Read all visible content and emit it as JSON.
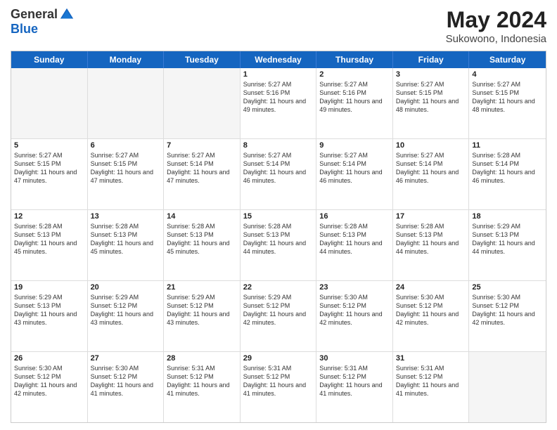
{
  "logo": {
    "general": "General",
    "blue": "Blue"
  },
  "title": {
    "month": "May 2024",
    "location": "Sukowono, Indonesia"
  },
  "calendar": {
    "headers": [
      "Sunday",
      "Monday",
      "Tuesday",
      "Wednesday",
      "Thursday",
      "Friday",
      "Saturday"
    ],
    "rows": [
      [
        {
          "day": "",
          "empty": true
        },
        {
          "day": "",
          "empty": true
        },
        {
          "day": "",
          "empty": true
        },
        {
          "day": "1",
          "sunrise": "5:27 AM",
          "sunset": "5:16 PM",
          "daylight": "11 hours and 49 minutes."
        },
        {
          "day": "2",
          "sunrise": "5:27 AM",
          "sunset": "5:16 PM",
          "daylight": "11 hours and 49 minutes."
        },
        {
          "day": "3",
          "sunrise": "5:27 AM",
          "sunset": "5:15 PM",
          "daylight": "11 hours and 48 minutes."
        },
        {
          "day": "4",
          "sunrise": "5:27 AM",
          "sunset": "5:15 PM",
          "daylight": "11 hours and 48 minutes."
        }
      ],
      [
        {
          "day": "5",
          "sunrise": "5:27 AM",
          "sunset": "5:15 PM",
          "daylight": "11 hours and 47 minutes."
        },
        {
          "day": "6",
          "sunrise": "5:27 AM",
          "sunset": "5:15 PM",
          "daylight": "11 hours and 47 minutes."
        },
        {
          "day": "7",
          "sunrise": "5:27 AM",
          "sunset": "5:14 PM",
          "daylight": "11 hours and 47 minutes."
        },
        {
          "day": "8",
          "sunrise": "5:27 AM",
          "sunset": "5:14 PM",
          "daylight": "11 hours and 46 minutes."
        },
        {
          "day": "9",
          "sunrise": "5:27 AM",
          "sunset": "5:14 PM",
          "daylight": "11 hours and 46 minutes."
        },
        {
          "day": "10",
          "sunrise": "5:27 AM",
          "sunset": "5:14 PM",
          "daylight": "11 hours and 46 minutes."
        },
        {
          "day": "11",
          "sunrise": "5:28 AM",
          "sunset": "5:14 PM",
          "daylight": "11 hours and 46 minutes."
        }
      ],
      [
        {
          "day": "12",
          "sunrise": "5:28 AM",
          "sunset": "5:13 PM",
          "daylight": "11 hours and 45 minutes."
        },
        {
          "day": "13",
          "sunrise": "5:28 AM",
          "sunset": "5:13 PM",
          "daylight": "11 hours and 45 minutes."
        },
        {
          "day": "14",
          "sunrise": "5:28 AM",
          "sunset": "5:13 PM",
          "daylight": "11 hours and 45 minutes."
        },
        {
          "day": "15",
          "sunrise": "5:28 AM",
          "sunset": "5:13 PM",
          "daylight": "11 hours and 44 minutes."
        },
        {
          "day": "16",
          "sunrise": "5:28 AM",
          "sunset": "5:13 PM",
          "daylight": "11 hours and 44 minutes."
        },
        {
          "day": "17",
          "sunrise": "5:28 AM",
          "sunset": "5:13 PM",
          "daylight": "11 hours and 44 minutes."
        },
        {
          "day": "18",
          "sunrise": "5:29 AM",
          "sunset": "5:13 PM",
          "daylight": "11 hours and 44 minutes."
        }
      ],
      [
        {
          "day": "19",
          "sunrise": "5:29 AM",
          "sunset": "5:13 PM",
          "daylight": "11 hours and 43 minutes."
        },
        {
          "day": "20",
          "sunrise": "5:29 AM",
          "sunset": "5:12 PM",
          "daylight": "11 hours and 43 minutes."
        },
        {
          "day": "21",
          "sunrise": "5:29 AM",
          "sunset": "5:12 PM",
          "daylight": "11 hours and 43 minutes."
        },
        {
          "day": "22",
          "sunrise": "5:29 AM",
          "sunset": "5:12 PM",
          "daylight": "11 hours and 42 minutes."
        },
        {
          "day": "23",
          "sunrise": "5:30 AM",
          "sunset": "5:12 PM",
          "daylight": "11 hours and 42 minutes."
        },
        {
          "day": "24",
          "sunrise": "5:30 AM",
          "sunset": "5:12 PM",
          "daylight": "11 hours and 42 minutes."
        },
        {
          "day": "25",
          "sunrise": "5:30 AM",
          "sunset": "5:12 PM",
          "daylight": "11 hours and 42 minutes."
        }
      ],
      [
        {
          "day": "26",
          "sunrise": "5:30 AM",
          "sunset": "5:12 PM",
          "daylight": "11 hours and 42 minutes."
        },
        {
          "day": "27",
          "sunrise": "5:30 AM",
          "sunset": "5:12 PM",
          "daylight": "11 hours and 41 minutes."
        },
        {
          "day": "28",
          "sunrise": "5:31 AM",
          "sunset": "5:12 PM",
          "daylight": "11 hours and 41 minutes."
        },
        {
          "day": "29",
          "sunrise": "5:31 AM",
          "sunset": "5:12 PM",
          "daylight": "11 hours and 41 minutes."
        },
        {
          "day": "30",
          "sunrise": "5:31 AM",
          "sunset": "5:12 PM",
          "daylight": "11 hours and 41 minutes."
        },
        {
          "day": "31",
          "sunrise": "5:31 AM",
          "sunset": "5:12 PM",
          "daylight": "11 hours and 41 minutes."
        },
        {
          "day": "",
          "empty": true
        }
      ]
    ]
  }
}
